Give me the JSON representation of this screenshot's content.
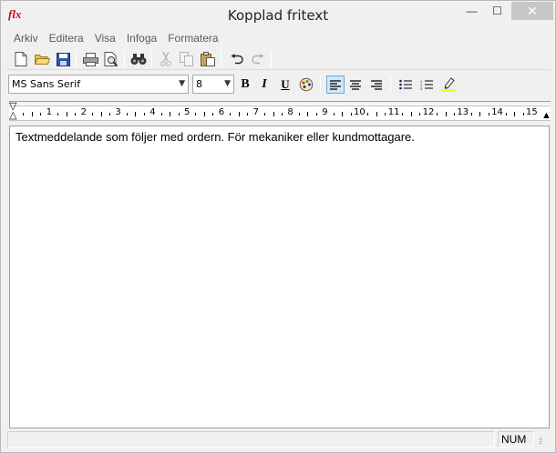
{
  "window": {
    "title": "Kopplad fritext",
    "app_icon_text": "flx",
    "minimize_glyph": "—",
    "maximize_glyph": "☐",
    "close_glyph": "✕"
  },
  "menu": {
    "items": [
      "Arkiv",
      "Editera",
      "Visa",
      "Infoga",
      "Formatera"
    ]
  },
  "toolbar": {
    "icons": [
      "new-document-icon",
      "open-folder-icon",
      "save-icon",
      "print-icon",
      "print-preview-icon",
      "find-icon",
      "cut-icon",
      "copy-icon",
      "paste-icon",
      "undo-icon",
      "redo-icon"
    ]
  },
  "format_toolbar": {
    "font_name": "MS Sans Serif",
    "font_size": "8",
    "bold_label": "B",
    "italic_label": "I",
    "underline_label": "U",
    "alignment_selected": "left"
  },
  "ruler": {
    "numbers": [
      "1",
      "2",
      "3",
      "4",
      "5",
      "6",
      "7",
      "8",
      "9",
      "10",
      "11",
      "12",
      "13",
      "14",
      "15"
    ]
  },
  "editor": {
    "text": "Textmeddelande som följer med ordern. För mekaniker eller kundmottagare."
  },
  "status": {
    "num_indicator": "NUM"
  },
  "colors": {
    "highlight": "#ffff00",
    "active_button_bg": "#cde6fb",
    "app_icon": "#c8102e"
  }
}
